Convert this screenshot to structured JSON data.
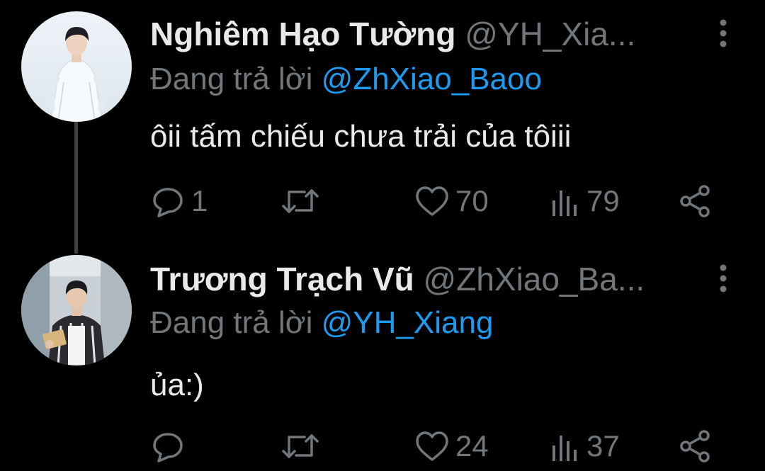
{
  "tweets": [
    {
      "display_name": "Nghiêm Hạo Tường",
      "handle": "@YH_Xia...",
      "reply_prefix": "Đang trả lời",
      "reply_to": "@ZhXiao_Baoo",
      "text": "ôii tấm chiếu chưa trải của tôiii",
      "replies": "1",
      "retweets": "",
      "likes": "70",
      "views": "79"
    },
    {
      "display_name": "Trương Trạch Vũ",
      "handle": "@ZhXiao_Ba...",
      "reply_prefix": "Đang trả lời",
      "reply_to": "@YH_Xiang",
      "text": "ủa:)",
      "replies": "",
      "retweets": "",
      "likes": "24",
      "views": "37"
    }
  ],
  "icons": {
    "reply": "reply-icon",
    "retweet": "retweet-icon",
    "like": "heart-icon",
    "views": "views-icon",
    "share": "share-icon",
    "more": "more-vertical-icon"
  },
  "colors": {
    "background": "#000000",
    "text": "#e7e9ea",
    "muted": "#71767b",
    "mention": "#1d9bf0",
    "thread_line": "#3e4144"
  }
}
